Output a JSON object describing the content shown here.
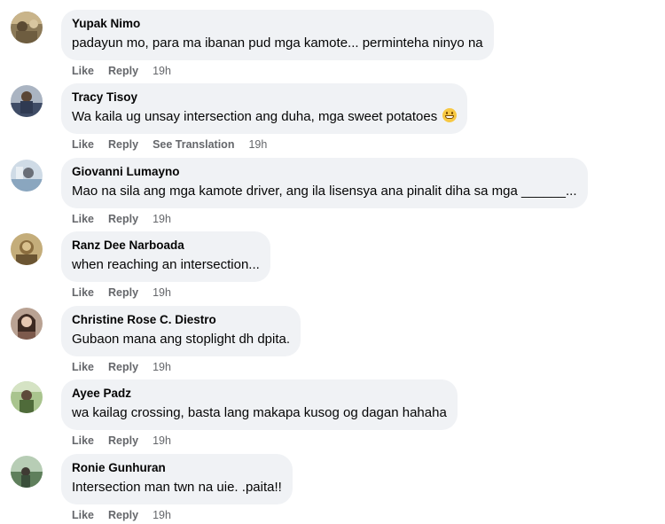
{
  "comments": [
    {
      "name": "Yupak Nimo",
      "text": "padayun mo, para ma ibanan pud mga kamote... perminteha ninyo na",
      "actions": [
        "Like",
        "Reply"
      ],
      "time": "19h",
      "avatar_color": "#7d6b4c"
    },
    {
      "name": "Tracy Tisoy",
      "text": "Wa kaila ug unsay intersection ang duha, mga sweet potatoes",
      "emoji": "grinning-face-emoji",
      "actions": [
        "Like",
        "Reply",
        "See Translation"
      ],
      "time": "19h",
      "avatar_color": "#4a5a78"
    },
    {
      "name": "Giovanni Lumayno",
      "text": "Mao na sila ang mga kamote driver, ang ila lisensya ana pinalit diha sa mga ______...",
      "actions": [
        "Like",
        "Reply"
      ],
      "time": "19h",
      "avatar_color": "#9ab3c9"
    },
    {
      "name": "Ranz Dee Narboada",
      "text": "when reaching an intersection...",
      "actions": [
        "Like",
        "Reply"
      ],
      "time": "19h",
      "avatar_color": "#a68d5b"
    },
    {
      "name": "Christine Rose C. Diestro",
      "text": "Gubaon mana ang stoplight dh dpita.",
      "actions": [
        "Like",
        "Reply"
      ],
      "time": "19h",
      "avatar_color": "#6b4f44"
    },
    {
      "name": "Ayee Padz",
      "text": "wa kailag crossing, basta lang makapa kusog og dagan hahaha",
      "actions": [
        "Like",
        "Reply"
      ],
      "time": "19h",
      "avatar_color": "#6f8a55"
    },
    {
      "name": "Ronie Gunhuran",
      "text": "Intersection man twn na uie. .paita!!",
      "actions": [
        "Like",
        "Reply"
      ],
      "time": "19h",
      "avatar_color": "#79947a"
    }
  ]
}
